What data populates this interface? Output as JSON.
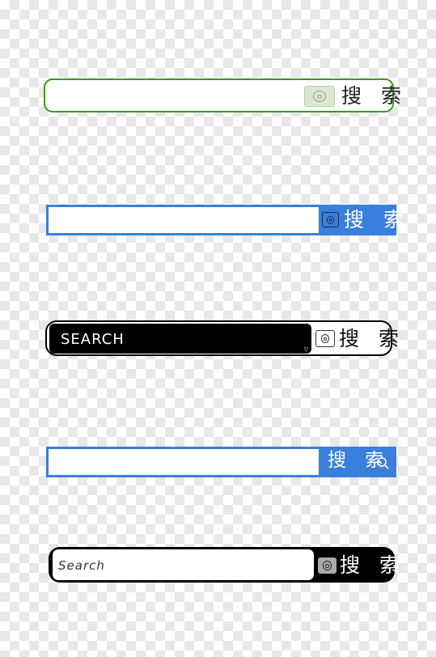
{
  "bars": [
    {
      "style": "green-rounded",
      "input_value": "",
      "button_label": "搜 索",
      "icon": "camera-icon",
      "accent": "#3a9a1a"
    },
    {
      "style": "blue-square",
      "input_value": "",
      "button_label": "搜 索",
      "icon": "camera-icon",
      "accent": "#3a7fdc"
    },
    {
      "style": "black-input",
      "placeholder": "SEARCH",
      "button_label": "搜 索",
      "icon": "camera-icon",
      "accent": "#000000"
    },
    {
      "style": "blue-square",
      "input_value": "",
      "button_label": "搜 索",
      "icon": "search-icon",
      "accent": "#3a7fdc"
    },
    {
      "style": "black-frame",
      "placeholder": "Search",
      "button_label": "搜 索",
      "icon": "camera-icon",
      "accent": "#000000"
    }
  ]
}
